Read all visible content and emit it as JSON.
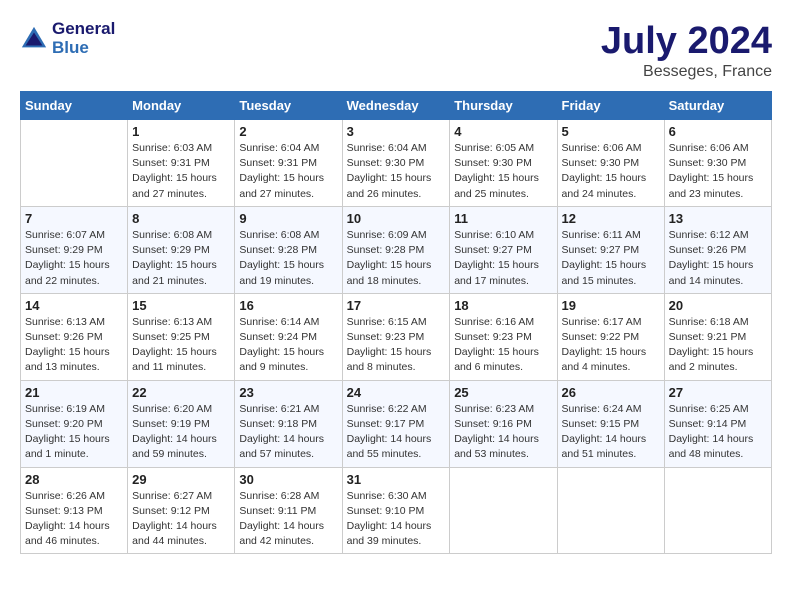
{
  "header": {
    "logo_line1": "General",
    "logo_line2": "Blue",
    "month_year": "July 2024",
    "location": "Besseges, France"
  },
  "columns": [
    "Sunday",
    "Monday",
    "Tuesday",
    "Wednesday",
    "Thursday",
    "Friday",
    "Saturday"
  ],
  "weeks": [
    [
      {
        "day": "",
        "sunrise": "",
        "sunset": "",
        "daylight": ""
      },
      {
        "day": "1",
        "sunrise": "Sunrise: 6:03 AM",
        "sunset": "Sunset: 9:31 PM",
        "daylight": "Daylight: 15 hours and 27 minutes."
      },
      {
        "day": "2",
        "sunrise": "Sunrise: 6:04 AM",
        "sunset": "Sunset: 9:31 PM",
        "daylight": "Daylight: 15 hours and 27 minutes."
      },
      {
        "day": "3",
        "sunrise": "Sunrise: 6:04 AM",
        "sunset": "Sunset: 9:30 PM",
        "daylight": "Daylight: 15 hours and 26 minutes."
      },
      {
        "day": "4",
        "sunrise": "Sunrise: 6:05 AM",
        "sunset": "Sunset: 9:30 PM",
        "daylight": "Daylight: 15 hours and 25 minutes."
      },
      {
        "day": "5",
        "sunrise": "Sunrise: 6:06 AM",
        "sunset": "Sunset: 9:30 PM",
        "daylight": "Daylight: 15 hours and 24 minutes."
      },
      {
        "day": "6",
        "sunrise": "Sunrise: 6:06 AM",
        "sunset": "Sunset: 9:30 PM",
        "daylight": "Daylight: 15 hours and 23 minutes."
      }
    ],
    [
      {
        "day": "7",
        "sunrise": "Sunrise: 6:07 AM",
        "sunset": "Sunset: 9:29 PM",
        "daylight": "Daylight: 15 hours and 22 minutes."
      },
      {
        "day": "8",
        "sunrise": "Sunrise: 6:08 AM",
        "sunset": "Sunset: 9:29 PM",
        "daylight": "Daylight: 15 hours and 21 minutes."
      },
      {
        "day": "9",
        "sunrise": "Sunrise: 6:08 AM",
        "sunset": "Sunset: 9:28 PM",
        "daylight": "Daylight: 15 hours and 19 minutes."
      },
      {
        "day": "10",
        "sunrise": "Sunrise: 6:09 AM",
        "sunset": "Sunset: 9:28 PM",
        "daylight": "Daylight: 15 hours and 18 minutes."
      },
      {
        "day": "11",
        "sunrise": "Sunrise: 6:10 AM",
        "sunset": "Sunset: 9:27 PM",
        "daylight": "Daylight: 15 hours and 17 minutes."
      },
      {
        "day": "12",
        "sunrise": "Sunrise: 6:11 AM",
        "sunset": "Sunset: 9:27 PM",
        "daylight": "Daylight: 15 hours and 15 minutes."
      },
      {
        "day": "13",
        "sunrise": "Sunrise: 6:12 AM",
        "sunset": "Sunset: 9:26 PM",
        "daylight": "Daylight: 15 hours and 14 minutes."
      }
    ],
    [
      {
        "day": "14",
        "sunrise": "Sunrise: 6:13 AM",
        "sunset": "Sunset: 9:26 PM",
        "daylight": "Daylight: 15 hours and 13 minutes."
      },
      {
        "day": "15",
        "sunrise": "Sunrise: 6:13 AM",
        "sunset": "Sunset: 9:25 PM",
        "daylight": "Daylight: 15 hours and 11 minutes."
      },
      {
        "day": "16",
        "sunrise": "Sunrise: 6:14 AM",
        "sunset": "Sunset: 9:24 PM",
        "daylight": "Daylight: 15 hours and 9 minutes."
      },
      {
        "day": "17",
        "sunrise": "Sunrise: 6:15 AM",
        "sunset": "Sunset: 9:23 PM",
        "daylight": "Daylight: 15 hours and 8 minutes."
      },
      {
        "day": "18",
        "sunrise": "Sunrise: 6:16 AM",
        "sunset": "Sunset: 9:23 PM",
        "daylight": "Daylight: 15 hours and 6 minutes."
      },
      {
        "day": "19",
        "sunrise": "Sunrise: 6:17 AM",
        "sunset": "Sunset: 9:22 PM",
        "daylight": "Daylight: 15 hours and 4 minutes."
      },
      {
        "day": "20",
        "sunrise": "Sunrise: 6:18 AM",
        "sunset": "Sunset: 9:21 PM",
        "daylight": "Daylight: 15 hours and 2 minutes."
      }
    ],
    [
      {
        "day": "21",
        "sunrise": "Sunrise: 6:19 AM",
        "sunset": "Sunset: 9:20 PM",
        "daylight": "Daylight: 15 hours and 1 minute."
      },
      {
        "day": "22",
        "sunrise": "Sunrise: 6:20 AM",
        "sunset": "Sunset: 9:19 PM",
        "daylight": "Daylight: 14 hours and 59 minutes."
      },
      {
        "day": "23",
        "sunrise": "Sunrise: 6:21 AM",
        "sunset": "Sunset: 9:18 PM",
        "daylight": "Daylight: 14 hours and 57 minutes."
      },
      {
        "day": "24",
        "sunrise": "Sunrise: 6:22 AM",
        "sunset": "Sunset: 9:17 PM",
        "daylight": "Daylight: 14 hours and 55 minutes."
      },
      {
        "day": "25",
        "sunrise": "Sunrise: 6:23 AM",
        "sunset": "Sunset: 9:16 PM",
        "daylight": "Daylight: 14 hours and 53 minutes."
      },
      {
        "day": "26",
        "sunrise": "Sunrise: 6:24 AM",
        "sunset": "Sunset: 9:15 PM",
        "daylight": "Daylight: 14 hours and 51 minutes."
      },
      {
        "day": "27",
        "sunrise": "Sunrise: 6:25 AM",
        "sunset": "Sunset: 9:14 PM",
        "daylight": "Daylight: 14 hours and 48 minutes."
      }
    ],
    [
      {
        "day": "28",
        "sunrise": "Sunrise: 6:26 AM",
        "sunset": "Sunset: 9:13 PM",
        "daylight": "Daylight: 14 hours and 46 minutes."
      },
      {
        "day": "29",
        "sunrise": "Sunrise: 6:27 AM",
        "sunset": "Sunset: 9:12 PM",
        "daylight": "Daylight: 14 hours and 44 minutes."
      },
      {
        "day": "30",
        "sunrise": "Sunrise: 6:28 AM",
        "sunset": "Sunset: 9:11 PM",
        "daylight": "Daylight: 14 hours and 42 minutes."
      },
      {
        "day": "31",
        "sunrise": "Sunrise: 6:30 AM",
        "sunset": "Sunset: 9:10 PM",
        "daylight": "Daylight: 14 hours and 39 minutes."
      },
      {
        "day": "",
        "sunrise": "",
        "sunset": "",
        "daylight": ""
      },
      {
        "day": "",
        "sunrise": "",
        "sunset": "",
        "daylight": ""
      },
      {
        "day": "",
        "sunrise": "",
        "sunset": "",
        "daylight": ""
      }
    ]
  ]
}
